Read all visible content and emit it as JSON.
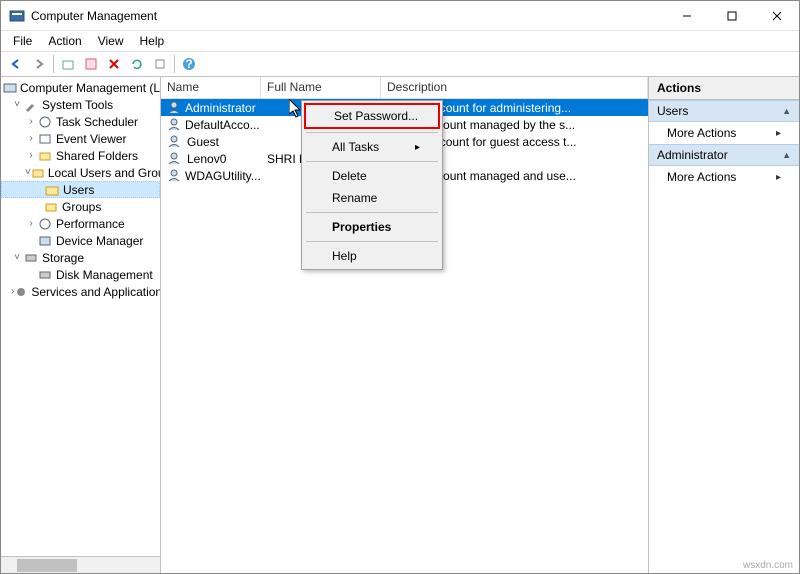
{
  "title": "Computer Management",
  "menus": [
    "File",
    "Action",
    "View",
    "Help"
  ],
  "tree": {
    "root": "Computer Management (Local)",
    "system_tools": "System Tools",
    "task_scheduler": "Task Scheduler",
    "event_viewer": "Event Viewer",
    "shared_folders": "Shared Folders",
    "local_users": "Local Users and Groups",
    "users": "Users",
    "groups": "Groups",
    "performance": "Performance",
    "device_manager": "Device Manager",
    "storage": "Storage",
    "disk_mgmt": "Disk Management",
    "services": "Services and Applications"
  },
  "list": {
    "headers": {
      "name": "Name",
      "fullname": "Full Name",
      "desc": "Description"
    },
    "rows": [
      {
        "name": "Administrator",
        "fullname": "",
        "desc": "Built-in account for administering..."
      },
      {
        "name": "DefaultAcco...",
        "fullname": "",
        "desc": "A user account managed by the s..."
      },
      {
        "name": "Guest",
        "fullname": "",
        "desc": "Built-in account for guest access t..."
      },
      {
        "name": "Lenov0",
        "fullname": "SHRI NID",
        "desc": ""
      },
      {
        "name": "WDAGUtility...",
        "fullname": "",
        "desc": "A user account managed and use..."
      }
    ]
  },
  "actions": {
    "title": "Actions",
    "section1": "Users",
    "more1": "More Actions",
    "section2": "Administrator",
    "more2": "More Actions"
  },
  "context_menu": {
    "set_password": "Set Password...",
    "all_tasks": "All Tasks",
    "delete": "Delete",
    "rename": "Rename",
    "properties": "Properties",
    "help": "Help"
  },
  "watermark": "wsxdn.com"
}
